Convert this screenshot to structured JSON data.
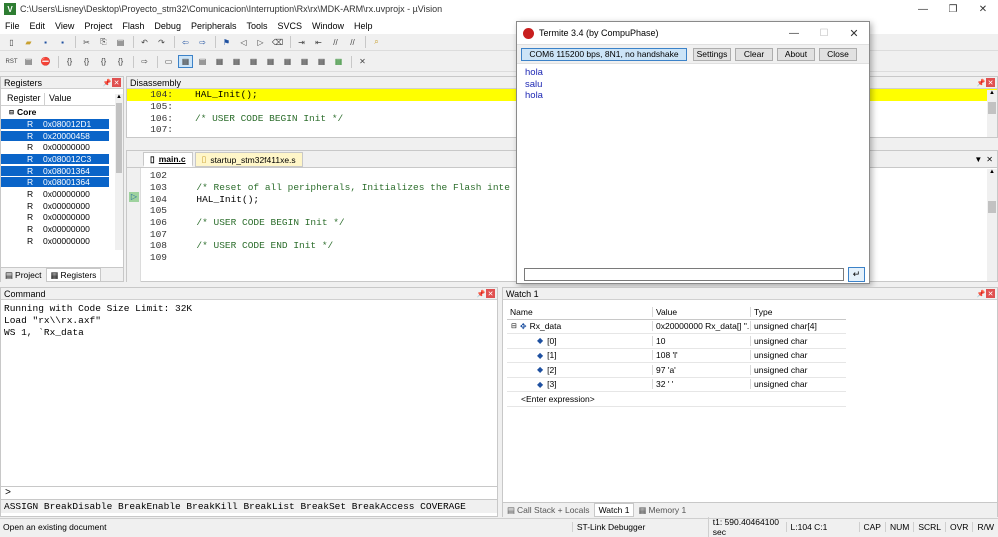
{
  "window": {
    "title": "C:\\Users\\Lisney\\Desktop\\Proyecto_stm32\\Comunicacion\\Interruption\\Rx\\rx\\MDK-ARM\\rx.uvprojx - µVision"
  },
  "menu": [
    "File",
    "Edit",
    "View",
    "Project",
    "Flash",
    "Debug",
    "Peripherals",
    "Tools",
    "SVCS",
    "Window",
    "Help"
  ],
  "registers": {
    "title": "Registers",
    "headers": {
      "register": "Register",
      "value": "Value"
    },
    "group": "Core",
    "rows": [
      {
        "reg": "R",
        "val": "0x080012D1",
        "sel": true
      },
      {
        "reg": "R",
        "val": "0x20000458",
        "sel": true
      },
      {
        "reg": "R",
        "val": "0x00000000",
        "sel": false
      },
      {
        "reg": "R",
        "val": "0x080012C3",
        "sel": true
      },
      {
        "reg": "R",
        "val": "0x08001364",
        "sel": true
      },
      {
        "reg": "R",
        "val": "0x08001364",
        "sel": true
      },
      {
        "reg": "R",
        "val": "0x00000000",
        "sel": false
      },
      {
        "reg": "R",
        "val": "0x00000000",
        "sel": false
      },
      {
        "reg": "R",
        "val": "0x00000000",
        "sel": false
      },
      {
        "reg": "R",
        "val": "0x00000000",
        "sel": false
      },
      {
        "reg": "R",
        "val": "0x00000000",
        "sel": false
      }
    ],
    "tabs": {
      "project": "Project",
      "registers": "Registers"
    }
  },
  "disassembly": {
    "title": "Disassembly",
    "lines": [
      {
        "ln": "104:",
        "code": "HAL_Init();",
        "hl": true
      },
      {
        "ln": "105:",
        "code": "",
        "hl": false
      },
      {
        "ln": "106:",
        "code": "/* USER CODE BEGIN Init */",
        "hl": false
      },
      {
        "ln": "107:",
        "code": "",
        "hl": false
      }
    ]
  },
  "editor": {
    "tabs": [
      "main.c",
      "startup_stm32f411xe.s"
    ],
    "lines": [
      {
        "ln": "102",
        "code": ""
      },
      {
        "ln": "103",
        "code": "  /* Reset of all peripherals, Initializes the Flash inte"
      },
      {
        "ln": "104",
        "code": "  HAL_Init();"
      },
      {
        "ln": "105",
        "code": ""
      },
      {
        "ln": "106",
        "code": "  /* USER CODE BEGIN Init */"
      },
      {
        "ln": "107",
        "code": ""
      },
      {
        "ln": "108",
        "code": "  /* USER CODE END Init */"
      },
      {
        "ln": "109",
        "code": ""
      }
    ]
  },
  "termite": {
    "title": "Termite 3.4 (by CompuPhase)",
    "port": "COM6 115200 bps, 8N1, no handshake",
    "buttons": {
      "settings": "Settings",
      "clear": "Clear",
      "about": "About",
      "close": "Close"
    },
    "received": [
      "hola",
      "salu",
      "hola"
    ],
    "input_value": ""
  },
  "command": {
    "title": "Command",
    "output": [
      "Running with Code Size Limit: 32K",
      "Load \"rx\\\\rx.axf\"",
      "WS 1, `Rx_data"
    ],
    "prompt": ">",
    "hints": "ASSIGN BreakDisable BreakEnable BreakKill BreakList BreakSet BreakAccess COVERAGE"
  },
  "watch": {
    "title": "Watch 1",
    "headers": {
      "name": "Name",
      "value": "Value",
      "type": "Type"
    },
    "rows": [
      {
        "name": "Rx_data",
        "value": "0x20000000 Rx_data[] \"...",
        "type": "unsigned char[4]",
        "indent": 0
      },
      {
        "name": "[0]",
        "value": "10",
        "type": "unsigned char",
        "indent": 1
      },
      {
        "name": "[1]",
        "value": "108 'l'",
        "type": "unsigned char",
        "indent": 1
      },
      {
        "name": "[2]",
        "value": "97 'a'",
        "type": "unsigned char",
        "indent": 1
      },
      {
        "name": "[3]",
        "value": "32 ' '",
        "type": "unsigned char",
        "indent": 1
      }
    ],
    "enter_expr": "<Enter expression>",
    "tabs": [
      "Call Stack + Locals",
      "Watch 1",
      "Memory 1"
    ]
  },
  "status": {
    "left": "Open an existing document",
    "debugger": "ST-Link Debugger",
    "time": "t1: 590.40464100 sec",
    "pos": "L:104 C:1",
    "flags": [
      "CAP",
      "NUM",
      "SCRL",
      "OVR",
      "R/W"
    ]
  }
}
